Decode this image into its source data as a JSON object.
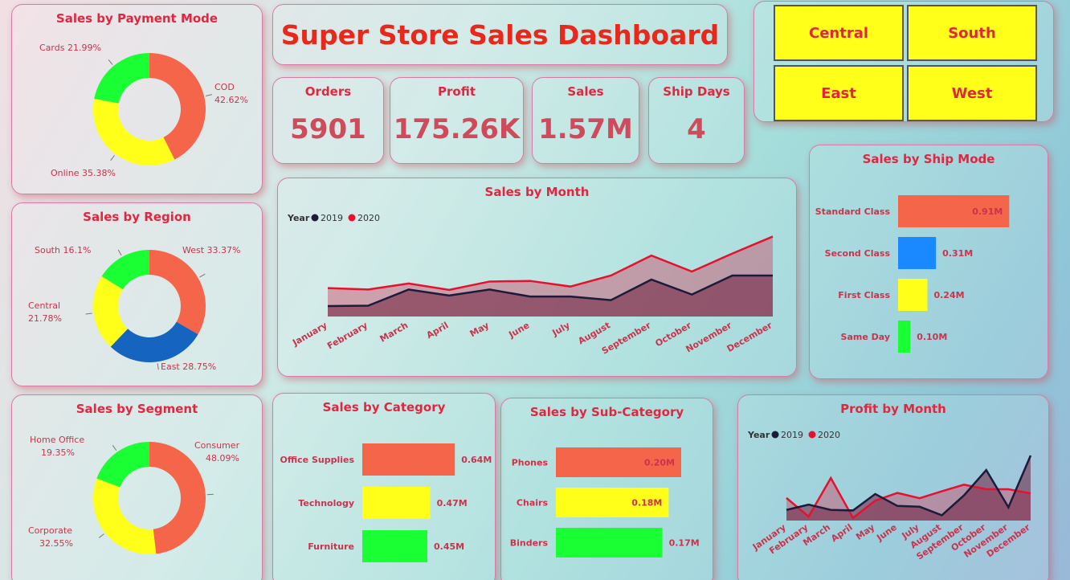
{
  "dashboard": {
    "title": "Super Store Sales Dashboard"
  },
  "kpis": [
    {
      "label": "Orders",
      "value": "5901"
    },
    {
      "label": "Profit",
      "value": "175.26K"
    },
    {
      "label": "Sales",
      "value": "1.57M"
    },
    {
      "label": "Ship Days",
      "value": "4"
    }
  ],
  "region_filters": [
    "Central",
    "South",
    "East",
    "West"
  ],
  "colors": {
    "accent_red": "#e2263f",
    "orange": "#f4654a",
    "yellow": "#ffff1a",
    "green": "#1aff33",
    "blue": "#1a88ff",
    "navy": "#1b1b3a",
    "line_2020": "#e8112d"
  },
  "chart_data": [
    {
      "id": "payment_mode",
      "type": "pie",
      "title": "Sales by Payment Mode",
      "slices": [
        {
          "label": "COD",
          "pct": "42.62%",
          "value": 42.62,
          "color": "#f4654a"
        },
        {
          "label": "Online",
          "pct": "35.38%",
          "value": 35.38,
          "color": "#ffff1a"
        },
        {
          "label": "Cards",
          "pct": "21.99%",
          "value": 21.99,
          "color": "#1aff33"
        }
      ]
    },
    {
      "id": "region",
      "type": "pie",
      "title": "Sales by Region",
      "slices": [
        {
          "label": "West",
          "pct": "33.37%",
          "value": 33.37,
          "color": "#f4654a"
        },
        {
          "label": "East",
          "pct": "28.75%",
          "value": 28.75,
          "color": "#1565c0"
        },
        {
          "label": "Central",
          "pct": "21.78%",
          "value": 21.78,
          "color": "#ffff1a"
        },
        {
          "label": "South",
          "pct": "16.1%",
          "value": 16.1,
          "color": "#1aff33"
        }
      ]
    },
    {
      "id": "segment",
      "type": "pie",
      "title": "Sales by Segment",
      "slices": [
        {
          "label": "Consumer",
          "pct": "48.09%",
          "value": 48.09,
          "color": "#f4654a"
        },
        {
          "label": "Corporate",
          "pct": "32.55%",
          "value": 32.55,
          "color": "#ffff1a"
        },
        {
          "label": "Home Office",
          "pct": "19.35%",
          "value": 19.35,
          "color": "#1aff33"
        }
      ]
    },
    {
      "id": "sales_by_month",
      "type": "area",
      "title": "Sales by Month",
      "legend_title": "Year",
      "legend_position": "top-left",
      "categories": [
        "January",
        "February",
        "March",
        "April",
        "May",
        "June",
        "July",
        "August",
        "September",
        "October",
        "November",
        "December"
      ],
      "series": [
        {
          "name": "2019",
          "color": "#1b1b3a",
          "values": [
            0.052,
            0.054,
            0.135,
            0.105,
            0.135,
            0.1,
            0.1,
            0.082,
            0.185,
            0.11,
            0.205,
            0.205
          ]
        },
        {
          "name": "2020",
          "color": "#e8112d",
          "values": [
            0.142,
            0.135,
            0.165,
            0.133,
            0.175,
            0.178,
            0.15,
            0.205,
            0.305,
            0.225,
            0.315,
            0.4
          ]
        }
      ],
      "ylim": [
        0,
        0.45
      ]
    },
    {
      "id": "ship_mode",
      "type": "bar",
      "title": "Sales by Ship Mode",
      "orientation": "horizontal",
      "categories": [
        "Standard Class",
        "Second Class",
        "First Class",
        "Same Day"
      ],
      "values": [
        0.91,
        0.31,
        0.24,
        0.1
      ],
      "labels": [
        "0.91M",
        "0.31M",
        "0.24M",
        "0.10M"
      ],
      "colors": [
        "#f4654a",
        "#1a88ff",
        "#ffff1a",
        "#1aff33"
      ]
    },
    {
      "id": "category",
      "type": "bar",
      "title": "Sales by Category",
      "orientation": "horizontal",
      "categories": [
        "Office Supplies",
        "Technology",
        "Furniture"
      ],
      "values": [
        0.64,
        0.47,
        0.45
      ],
      "labels": [
        "0.64M",
        "0.47M",
        "0.45M"
      ],
      "colors": [
        "#f4654a",
        "#ffff1a",
        "#1aff33"
      ]
    },
    {
      "id": "sub_category",
      "type": "bar",
      "title": "Sales by Sub-Category",
      "orientation": "horizontal",
      "categories": [
        "Phones",
        "Chairs",
        "Binders"
      ],
      "values": [
        0.2,
        0.18,
        0.17
      ],
      "labels": [
        "0.20M",
        "0.18M",
        "0.17M"
      ],
      "colors": [
        "#f4654a",
        "#ffff1a",
        "#1aff33"
      ]
    },
    {
      "id": "profit_by_month",
      "type": "area",
      "title": "Profit by Month",
      "legend_title": "Year",
      "legend_position": "top-left",
      "categories": [
        "January",
        "February",
        "March",
        "April",
        "May",
        "June",
        "July",
        "August",
        "September",
        "October",
        "November",
        "December"
      ],
      "series": [
        {
          "name": "2019",
          "color": "#1b1b3a",
          "values": [
            4,
            6,
            4,
            3.8,
            10,
            5.5,
            5.2,
            2,
            9.5,
            19,
            5,
            24.5
          ]
        },
        {
          "name": "2020",
          "color": "#e8112d",
          "values": [
            8.5,
            1.5,
            16,
            1,
            7.5,
            10.4,
            8.4,
            11,
            13.5,
            11.8,
            11.8,
            10.2
          ]
        }
      ],
      "ylim": [
        0,
        26
      ]
    }
  ]
}
